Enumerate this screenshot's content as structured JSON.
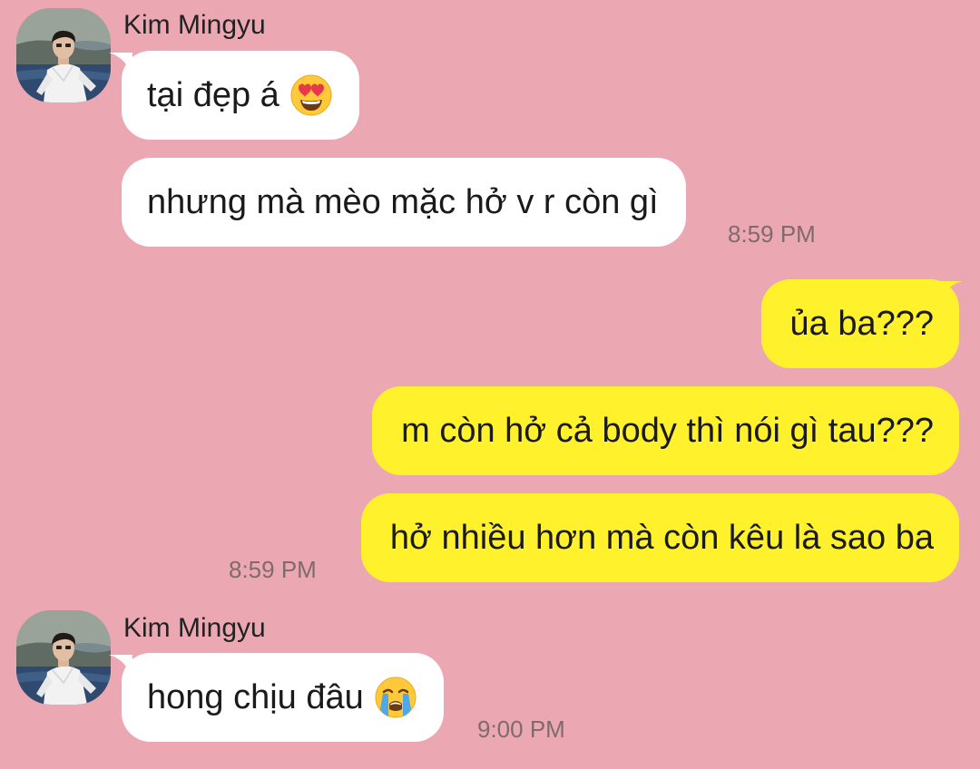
{
  "theme": {
    "background": "#eca8b2",
    "incoming_bubble": "#ffffff",
    "outgoing_bubble": "#fff12c"
  },
  "groups": [
    {
      "sender": "Kim Mingyu",
      "messages": [
        {
          "text": "tại đẹp á",
          "emoji": "heart-eyes-emoji"
        },
        {
          "text": "nhưng mà mèo mặc hở v r còn gì",
          "time": "8:59 PM"
        }
      ]
    },
    {
      "sender": "",
      "messages": [
        {
          "text": "ủa ba???"
        },
        {
          "text": "m còn hở cả body thì nói gì tau???"
        },
        {
          "text": "hở nhiều hơn mà còn kêu là sao ba",
          "time": "8:59 PM"
        }
      ]
    },
    {
      "sender": "Kim Mingyu",
      "messages": [
        {
          "text": "hong chịu đâu",
          "emoji": "crying-emoji",
          "time": "9:00 PM"
        }
      ]
    }
  ]
}
